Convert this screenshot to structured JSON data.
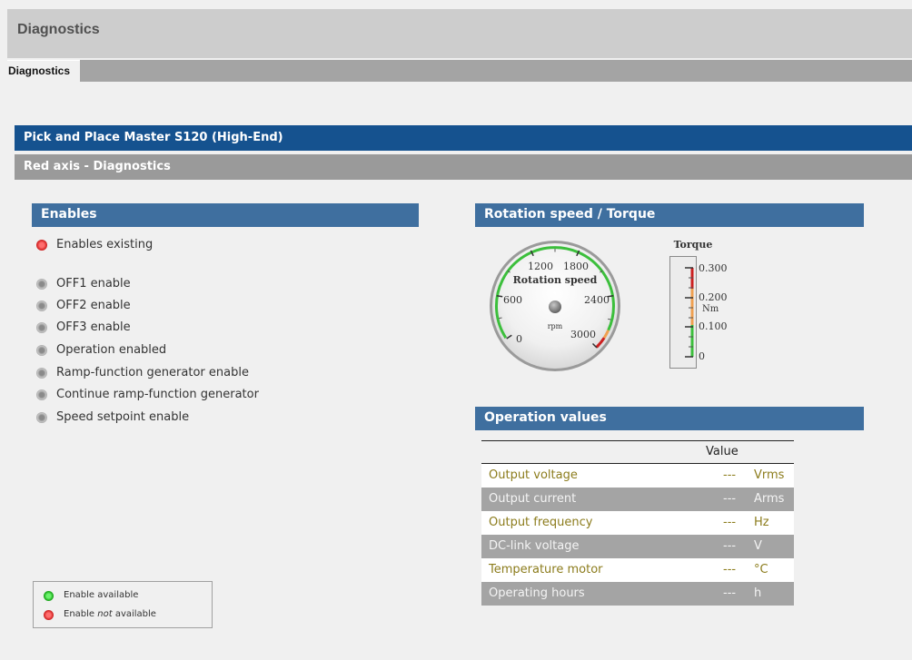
{
  "header": {
    "title": "Diagnostics"
  },
  "tabs": [
    {
      "label": "Diagnostics"
    }
  ],
  "device": {
    "title": "Pick and Place Master S120 (High-End)"
  },
  "axis": {
    "title": "Red axis - Diagnostics"
  },
  "enables": {
    "heading": "Enables",
    "existing": {
      "label": "Enables existing",
      "state": "not-available"
    },
    "items": [
      {
        "label": "OFF1 enable",
        "state": "unknown"
      },
      {
        "label": "OFF2 enable",
        "state": "unknown"
      },
      {
        "label": "OFF3 enable",
        "state": "unknown"
      },
      {
        "label": "Operation enabled",
        "state": "unknown"
      },
      {
        "label": "Ramp-function generator enable",
        "state": "unknown"
      },
      {
        "label": "Continue ramp-function generator",
        "state": "unknown"
      },
      {
        "label": "Speed setpoint enable",
        "state": "unknown"
      }
    ]
  },
  "legend": {
    "available": "Enable available",
    "not_prefix": "Enable ",
    "not_word": "not",
    "not_suffix": " available"
  },
  "rotation": {
    "heading": "Rotation speed / Torque",
    "speed_gauge": {
      "title": "Rotation speed",
      "unit": "rpm",
      "ticks": [
        "0",
        "600",
        "1200",
        "1800",
        "2400",
        "3000"
      ]
    },
    "torque_gauge": {
      "title": "Torque",
      "unit": "Nm",
      "ticks": [
        "0.300",
        "0.200",
        "0.100",
        "0"
      ]
    }
  },
  "operation": {
    "heading": "Operation values",
    "value_header": "Value",
    "rows": [
      {
        "name": "Output voltage",
        "value": "---",
        "unit": "Vrms"
      },
      {
        "name": "Output current",
        "value": "---",
        "unit": "Arms"
      },
      {
        "name": "Output frequency",
        "value": "---",
        "unit": "Hz"
      },
      {
        "name": "DC-link voltage",
        "value": "---",
        "unit": "V"
      },
      {
        "name": "Temperature motor",
        "value": "---",
        "unit": "°C"
      },
      {
        "name": "Operating hours",
        "value": "---",
        "unit": "h"
      }
    ]
  },
  "colors": {
    "header_band": "#15528f",
    "section_head": "#3f6f9f",
    "gauge_green": "#3cbf3c",
    "gauge_orange": "#f0a050",
    "gauge_red": "#cc2020"
  }
}
